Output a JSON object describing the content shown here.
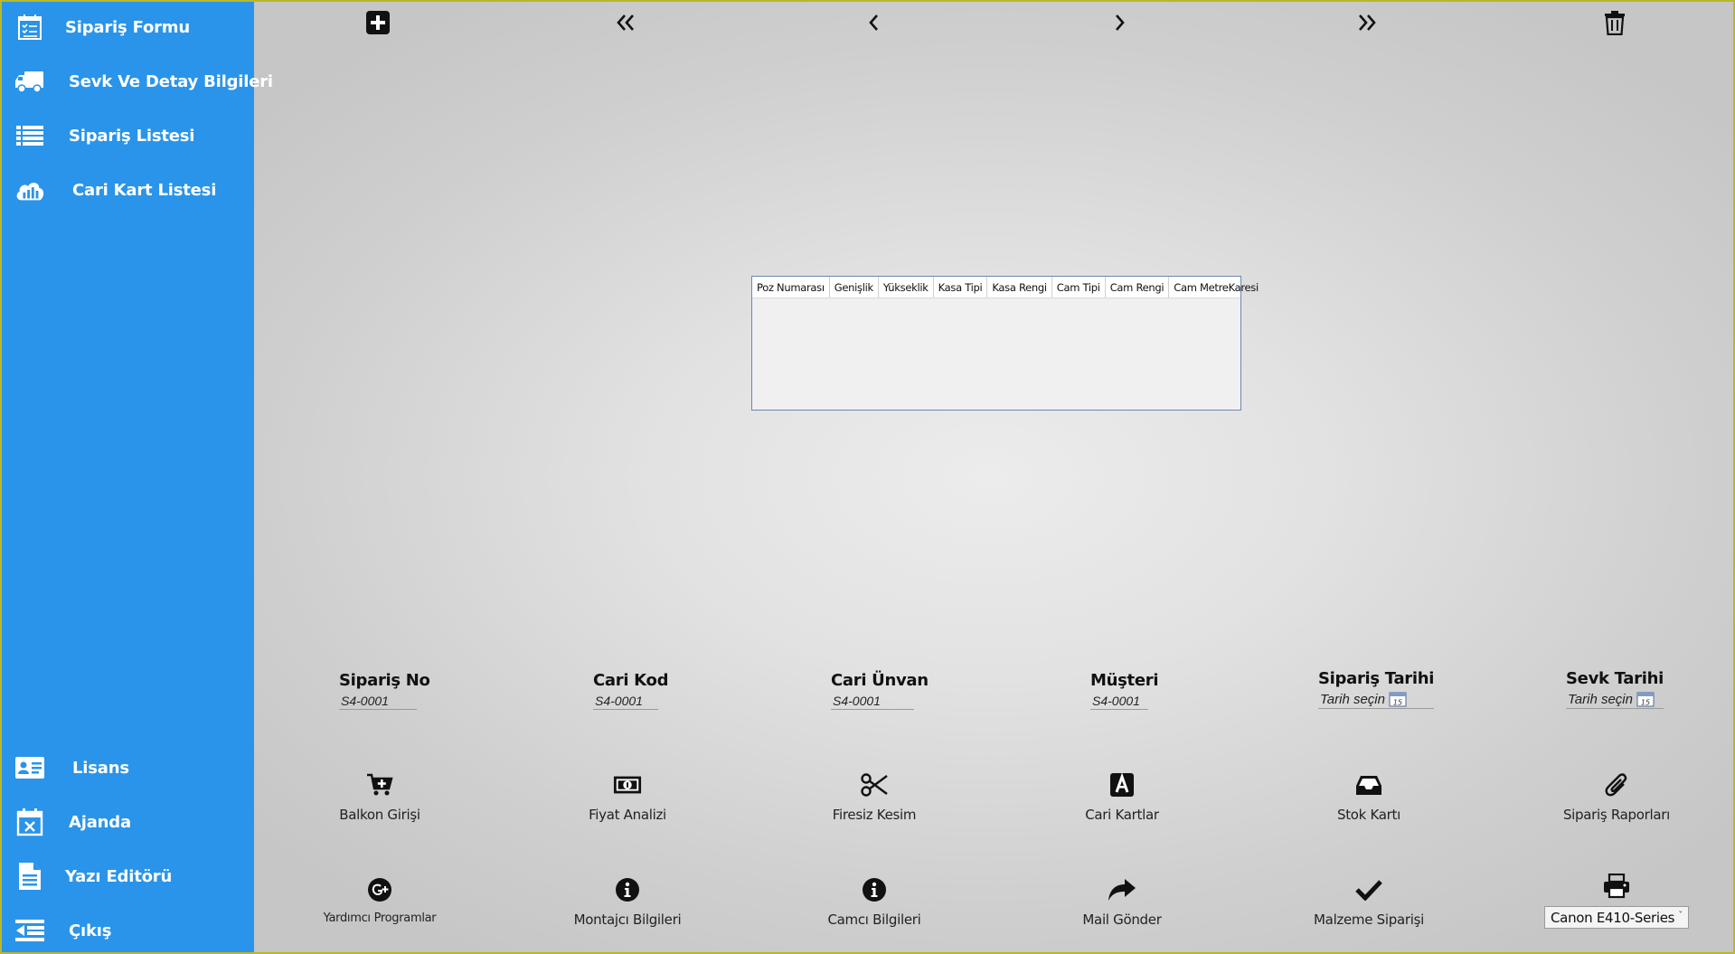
{
  "sidebar": {
    "top_items": [
      {
        "label": "Sipariş Formu",
        "icon": "order-form-icon"
      },
      {
        "label": "Sevk Ve Detay Bilgileri",
        "icon": "truck-icon"
      },
      {
        "label": "Sipariş Listesi",
        "icon": "list-icon"
      },
      {
        "label": "Cari Kart Listesi",
        "icon": "cloud-chart-icon"
      }
    ],
    "bottom_items": [
      {
        "label": "Lisans",
        "icon": "id-card-icon"
      },
      {
        "label": "Ajanda",
        "icon": "calendar-x-icon"
      },
      {
        "label": "Yazı Editörü",
        "icon": "document-icon"
      },
      {
        "label": "Çıkış",
        "icon": "exit-icon"
      }
    ],
    "background_color": "#2994ea"
  },
  "toolbar": {
    "buttons": [
      {
        "icon": "plus-square-icon"
      },
      {
        "icon": "double-chevron-left-icon"
      },
      {
        "icon": "chevron-left-icon"
      },
      {
        "icon": "chevron-right-icon"
      },
      {
        "icon": "double-chevron-right-icon"
      },
      {
        "icon": "trash-icon"
      }
    ]
  },
  "grid": {
    "columns": [
      "Poz Numarası",
      "Genişlik",
      "Yükseklik",
      "Kasa Tipi",
      "Kasa Rengi",
      "Cam Tipi",
      "Cam Rengi",
      "Cam MetreKaresi"
    ],
    "rows": []
  },
  "fields": {
    "siparis_no": {
      "label": "Sipariş No",
      "value": "S4-0001"
    },
    "cari_kod": {
      "label": "Cari Kod",
      "value": "S4-0001"
    },
    "cari_unvan": {
      "label": "Cari Ünvan",
      "value": "S4-0001"
    },
    "musteri": {
      "label": "Müşteri",
      "value": "S4-0001"
    },
    "siparis_tarihi": {
      "label": "Sipariş Tarihi",
      "placeholder": "Tarih seçin",
      "calendar_day": "15"
    },
    "sevk_tarihi": {
      "label": "Sevk Tarihi",
      "placeholder": "Tarih seçin",
      "calendar_day": "15"
    }
  },
  "actions_row1": [
    {
      "label": "Balkon Girişi",
      "icon": "cart-plus-icon"
    },
    {
      "label": "Fiyat Analizi",
      "icon": "money-bill-icon"
    },
    {
      "label": "Firesiz Kesim",
      "icon": "scissors-icon"
    },
    {
      "label": "Cari Kartlar",
      "icon": "font-a-icon"
    },
    {
      "label": "Stok Kartı",
      "icon": "inbox-icon"
    },
    {
      "label": "Sipariş Raporları",
      "icon": "paperclip-icon"
    }
  ],
  "actions_row2": [
    {
      "label": "Yardımcı Programlar",
      "icon": "google-plus-icon"
    },
    {
      "label": "Montajcı Bilgileri",
      "icon": "info-icon"
    },
    {
      "label": "Camcı Bilgileri",
      "icon": "info-icon"
    },
    {
      "label": "Mail Gönder",
      "icon": "share-arrow-icon"
    },
    {
      "label": "Malzeme Siparişi",
      "icon": "check-icon"
    },
    {
      "label": "printer",
      "icon": "printer-icon"
    }
  ],
  "printer_select": {
    "selected": "Canon E410-Series"
  }
}
